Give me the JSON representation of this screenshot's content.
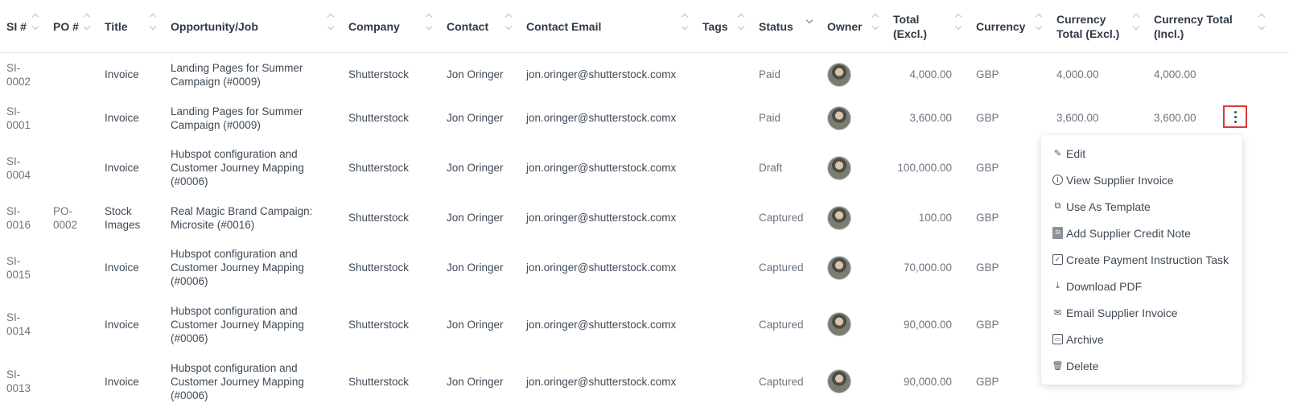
{
  "table": {
    "columns": [
      {
        "label": "SI #"
      },
      {
        "label": "PO #"
      },
      {
        "label": "Title"
      },
      {
        "label": "Opportunity/Job"
      },
      {
        "label": "Company"
      },
      {
        "label": "Contact"
      },
      {
        "label": "Contact Email"
      },
      {
        "label": "Tags"
      },
      {
        "label": "Status"
      },
      {
        "label": "Owner"
      },
      {
        "label": "Total (Excl.)"
      },
      {
        "label": "Currency"
      },
      {
        "label": "Currency Total (Excl.)"
      },
      {
        "label": "Currency Total (Incl.)"
      }
    ],
    "rows": [
      {
        "si": "SI-0002",
        "po": "",
        "title": "Invoice",
        "job": "Landing Pages for Summer Campaign (#0009)",
        "company": "Shutterstock",
        "contact": "Jon Oringer",
        "email": "jon.oringer@shutterstock.comx",
        "tags": "",
        "status": "Paid",
        "total": "4,000.00",
        "currency": "GBP",
        "cur_excl": "4,000.00",
        "cur_incl": "4,000.00"
      },
      {
        "si": "SI-0001",
        "po": "",
        "title": "Invoice",
        "job": "Landing Pages for Summer Campaign (#0009)",
        "company": "Shutterstock",
        "contact": "Jon Oringer",
        "email": "jon.oringer@shutterstock.comx",
        "tags": "",
        "status": "Paid",
        "total": "3,600.00",
        "currency": "GBP",
        "cur_excl": "3,600.00",
        "cur_incl": "3,600.00"
      },
      {
        "si": "SI-0004",
        "po": "",
        "title": "Invoice",
        "job": "Hubspot configuration and Customer Journey Mapping (#0006)",
        "company": "Shutterstock",
        "contact": "Jon Oringer",
        "email": "jon.oringer@shutterstock.comx",
        "tags": "",
        "status": "Draft",
        "total": "100,000.00",
        "currency": "GBP",
        "cur_excl": "",
        "cur_incl": ""
      },
      {
        "si": "SI-0016",
        "po": "PO-0002",
        "title": "Stock Images",
        "job": "Real Magic Brand Campaign: Microsite (#0016)",
        "company": "Shutterstock",
        "contact": "Jon Oringer",
        "email": "jon.oringer@shutterstock.comx",
        "tags": "",
        "status": "Captured",
        "total": "100.00",
        "currency": "GBP",
        "cur_excl": "",
        "cur_incl": ""
      },
      {
        "si": "SI-0015",
        "po": "",
        "title": "Invoice",
        "job": "Hubspot configuration and Customer Journey Mapping (#0006)",
        "company": "Shutterstock",
        "contact": "Jon Oringer",
        "email": "jon.oringer@shutterstock.comx",
        "tags": "",
        "status": "Captured",
        "total": "70,000.00",
        "currency": "GBP",
        "cur_excl": "",
        "cur_incl": ""
      },
      {
        "si": "SI-0014",
        "po": "",
        "title": "Invoice",
        "job": "Hubspot configuration and Customer Journey Mapping (#0006)",
        "company": "Shutterstock",
        "contact": "Jon Oringer",
        "email": "jon.oringer@shutterstock.comx",
        "tags": "",
        "status": "Captured",
        "total": "90,000.00",
        "currency": "GBP",
        "cur_excl": "",
        "cur_incl": ""
      },
      {
        "si": "SI-0013",
        "po": "",
        "title": "Invoice",
        "job": "Hubspot configuration and Customer Journey Mapping (#0006)",
        "company": "Shutterstock",
        "contact": "Jon Oringer",
        "email": "jon.oringer@shutterstock.comx",
        "tags": "",
        "status": "Captured",
        "total": "90,000.00",
        "currency": "GBP",
        "cur_excl": "",
        "cur_incl": ""
      }
    ]
  },
  "menu": {
    "items": [
      {
        "label": "Edit",
        "icon": "edit-icon"
      },
      {
        "label": "View Supplier Invoice",
        "icon": "info-icon"
      },
      {
        "label": "Use As Template",
        "icon": "copy-icon"
      },
      {
        "label": "Add Supplier Credit Note",
        "icon": "document-icon"
      },
      {
        "label": "Create Payment Instruction Task",
        "icon": "checkbox-icon"
      },
      {
        "label": "Download PDF",
        "icon": "download-icon"
      },
      {
        "label": "Email Supplier Invoice",
        "icon": "mail-icon"
      },
      {
        "label": "Archive",
        "icon": "archive-icon"
      },
      {
        "label": "Delete",
        "icon": "trash-icon"
      }
    ]
  },
  "colors": {
    "highlight_border": "#d83a3a",
    "text": "#3f4a56"
  }
}
